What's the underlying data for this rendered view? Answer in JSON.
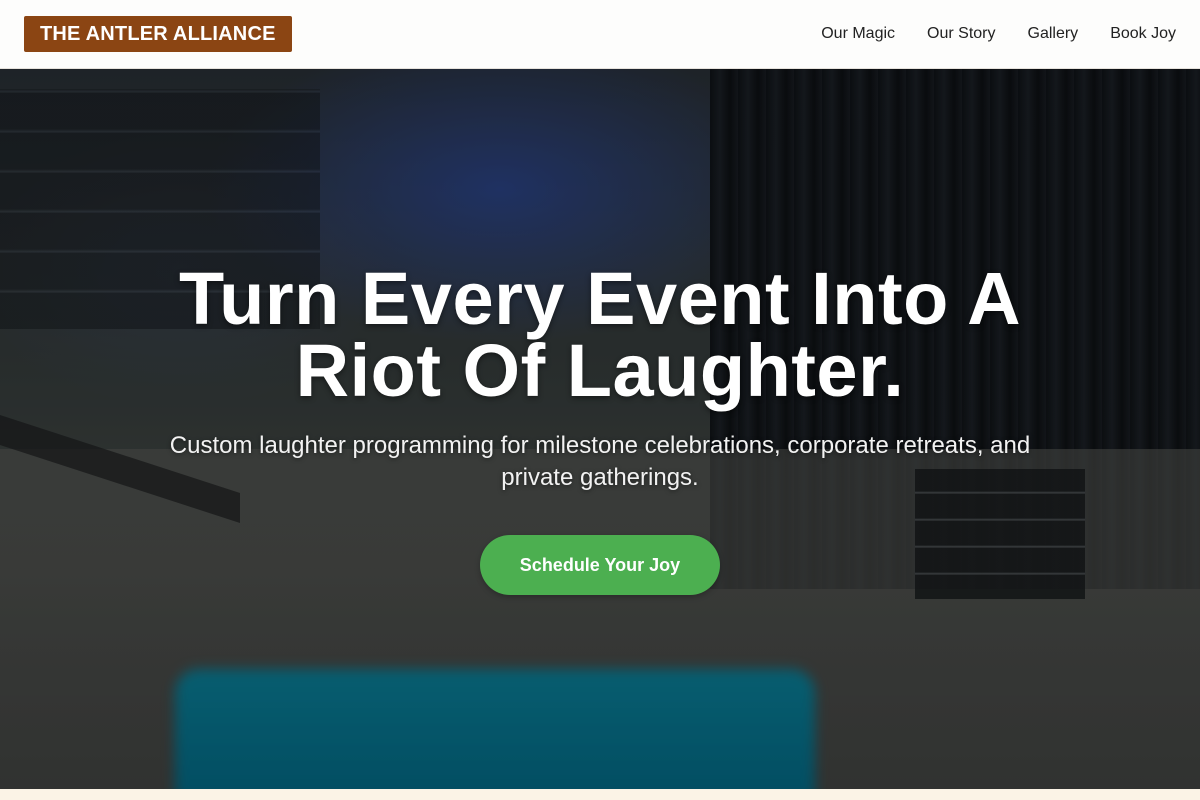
{
  "header": {
    "logo_text": "THE ANTLER ALLIANCE",
    "nav": [
      {
        "label": "Our Magic"
      },
      {
        "label": "Our Story"
      },
      {
        "label": "Gallery"
      },
      {
        "label": "Book Joy"
      }
    ]
  },
  "hero": {
    "title": "Turn Every Event Into A Riot Of Laughter.",
    "subtitle": "Custom laughter programming for milestone celebrations, corporate retreats, and private gatherings.",
    "cta_label": "Schedule Your Joy"
  },
  "colors": {
    "brand": "#8b4513",
    "cta": "#4caf50",
    "header_bg": "#fdfdfc"
  }
}
